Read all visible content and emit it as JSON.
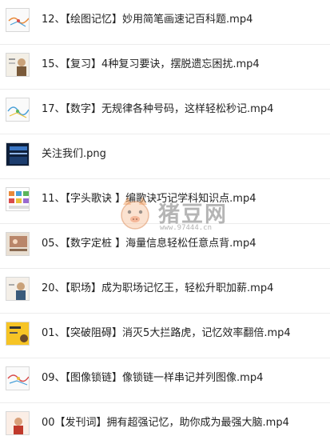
{
  "files": [
    {
      "name": "12、【绘图记忆】妙用简笔画速记百科题.mp4",
      "icon": "mindmap-thumb"
    },
    {
      "name": "15、【复习】4种复习要诀，摆脱遗忘困扰.mp4",
      "icon": "person-thumb"
    },
    {
      "name": "17、【数字】无规律各种号码，这样轻松秒记.mp4",
      "icon": "mindmap-thumb"
    },
    {
      "name": "关注我们.png",
      "icon": "dark-banner-thumb"
    },
    {
      "name": "11、【字头歌诀 】编歌诀巧记学科知识点.mp4",
      "icon": "grid-thumb"
    },
    {
      "name": "05、【数字定桩 】海量信息轻松任意点背.mp4",
      "icon": "photo-thumb"
    },
    {
      "name": "20、【职场】成为职场记忆王，轻松升职加薪.mp4",
      "icon": "person-thumb"
    },
    {
      "name": "01、【突破阻碍】消灭5大拦路虎，记忆效率翻倍.mp4",
      "icon": "yellow-thumb"
    },
    {
      "name": "09、【图像锁链】像锁链一样串记并列图像.mp4",
      "icon": "mindmap-thumb"
    },
    {
      "name": "00【发刊词】拥有超强记忆，助你成为最强大脑.mp4",
      "icon": "person-thumb"
    }
  ],
  "watermark": {
    "text": "猪豆网",
    "url": "www.97444.cn"
  },
  "colors": {
    "border": "#ececec",
    "text": "#222222",
    "accent_orange": "#f0a060"
  }
}
